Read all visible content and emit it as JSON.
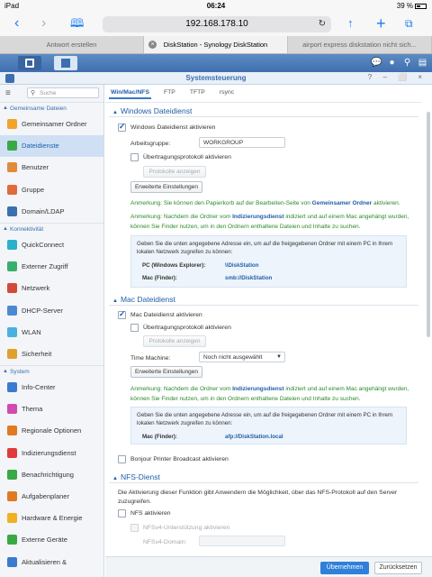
{
  "status": {
    "carrier": "iPad",
    "time": "06:24",
    "battery": "39 %",
    "battery_level": 0.39
  },
  "safari": {
    "url": "192.168.178.10"
  },
  "tabs": [
    {
      "label": "Antwort erstellen"
    },
    {
      "label": "DiskStation - Synology DiskStation"
    },
    {
      "label": "airport express diskstation nicht sich..."
    }
  ],
  "window": {
    "title": "Systemsteuerung"
  },
  "sidebar": {
    "search_placeholder": "Suche",
    "sections": [
      {
        "label": "Gemeinsame Dateien"
      },
      {
        "label": "Konnektivität"
      },
      {
        "label": "System"
      }
    ],
    "items": [
      {
        "label": "Gemeinsamer Ordner",
        "color": "#f0a42b"
      },
      {
        "label": "Dateidienste",
        "color": "#3aa845"
      },
      {
        "label": "Benutzer",
        "color": "#e08a3a"
      },
      {
        "label": "Gruppe",
        "color": "#e06a3a"
      },
      {
        "label": "Domain/LDAP",
        "color": "#3c6fb0"
      },
      {
        "label": "QuickConnect",
        "color": "#2ab0c8"
      },
      {
        "label": "Externer Zugriff",
        "color": "#38b06c"
      },
      {
        "label": "Netzwerk",
        "color": "#d04a3a"
      },
      {
        "label": "DHCP-Server",
        "color": "#4b8ad0"
      },
      {
        "label": "WLAN",
        "color": "#4bb0e0"
      },
      {
        "label": "Sicherheit",
        "color": "#e0a030"
      },
      {
        "label": "Info-Center",
        "color": "#3a7ad0"
      },
      {
        "label": "Thema",
        "color": "#d04ab0"
      },
      {
        "label": "Regionale Optionen",
        "color": "#e07a20"
      },
      {
        "label": "Indizierungsdienst",
        "color": "#e03a3a"
      },
      {
        "label": "Benachrichtigung",
        "color": "#3aa845"
      },
      {
        "label": "Aufgabenplaner",
        "color": "#e07a20"
      },
      {
        "label": "Hardware & Energie",
        "color": "#f0b020"
      },
      {
        "label": "Externe Geräte",
        "color": "#3aa845"
      },
      {
        "label": "Aktualisieren &",
        "color": "#3a7ad0"
      }
    ]
  },
  "subtabs": [
    "Win/Mac/NFS",
    "FTP",
    "TFTP",
    "rsync"
  ],
  "windows": {
    "heading": "Windows Dateidienst",
    "enable": "Windows Dateidienst aktivieren",
    "workgroup_label": "Arbeitsgruppe:",
    "workgroup_value": "WORKGROUP",
    "transfer_log": "Übertragungsprotokoll aktivieren",
    "show_logs": "Protokolle anzeigen",
    "advanced": "Erweiterte Einstellungen",
    "note1_prefix": "Anmerkung:",
    "note1_text": "Sie können den Papierkorb auf der Bearbeiten-Seite von",
    "note1_link": "Gemeinsamer Ordner",
    "note1_suffix": "aktivieren.",
    "note2_prefix": "Anmerkung:",
    "note2_a": "Nachdem die Ordner vom",
    "note2_link": "Indizierungsdienst",
    "note2_b": "indiziert und auf einem Mac angehängt wurden,",
    "note2_c": "können Sie Finder nutzen, um in den Ordnern enthaltene Dateien und Inhalte zu suchen.",
    "info_text_1": "Geben Sie die unten angegebene Adresse ein, um auf die freigegebenen Ordner mit einem PC in Ihrem",
    "info_text_2": "lokalen Netzwerk zugreifen zu können:",
    "pc_label": "PC (Windows Explorer):",
    "pc_value": "\\\\DiskStation",
    "mac_label": "Mac (Finder):",
    "mac_value": "smb://DiskStation"
  },
  "mac": {
    "heading": "Mac Dateidienst",
    "enable": "Mac Dateidienst aktivieren",
    "transfer_log": "Übertragungsprotokoll aktivieren",
    "show_logs": "Protokolle anzeigen",
    "time_machine_label": "Time Machine:",
    "time_machine_value": "Noch nicht ausgewählt",
    "advanced": "Erweiterte Einstellungen",
    "note_prefix": "Anmerkung:",
    "note_a": "Nachdem die Ordner vom",
    "note_link": "Indizierungsdienst",
    "note_b": "indiziert und auf einem Mac angehängt wurden,",
    "note_c": "können Sie Finder nutzen, um in den Ordnern enthaltene Dateien und Inhalte zu suchen.",
    "info_text_1": "Geben Sie die unten angegebene Adresse ein, um auf die freigegebenen Ordner mit einem PC in Ihrem",
    "info_text_2": "lokalen Netzwerk zugreifen zu können:",
    "mac_label": "Mac (Finder):",
    "mac_value": "afp://DiskStation.local",
    "bonjour": "Bonjour Printer Broadcast aktivieren"
  },
  "nfs": {
    "heading": "NFS-Dienst",
    "desc_1": "Die Aktivierung dieser Funktion gibt Anwendern die Möglichkeit, über das NFS-Protokoll auf den Server",
    "desc_2": "zuzugreifen.",
    "enable": "NFS aktivieren",
    "v4": "NFSv4-Unterstützung aktivieren",
    "v4_domain": "NFSv4-Domain:"
  },
  "footer": {
    "ok": "Übernehmen",
    "cancel": "Zurücksetzen"
  }
}
